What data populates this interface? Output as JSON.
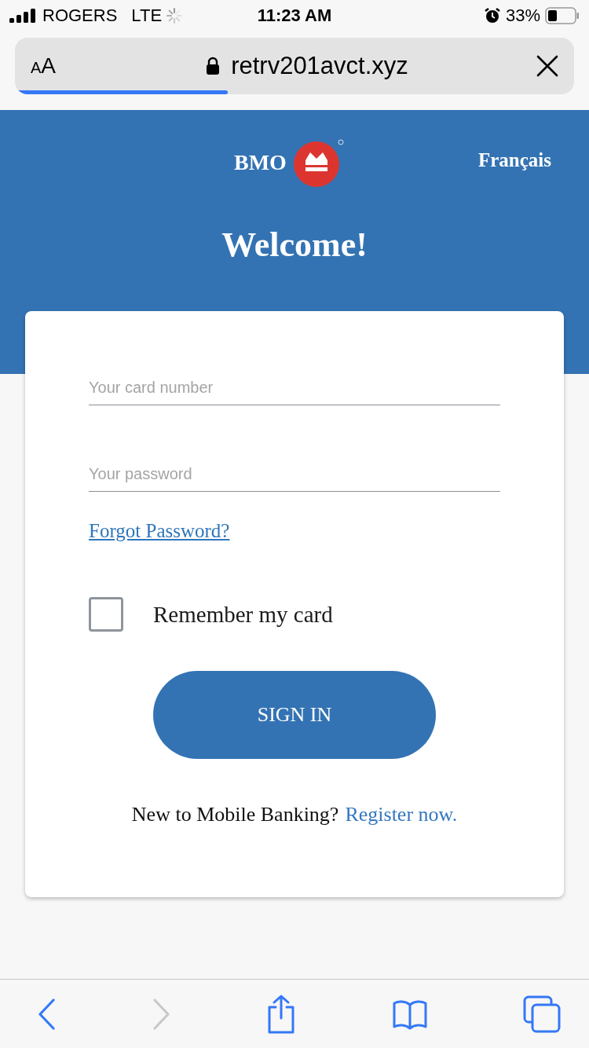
{
  "status_bar": {
    "carrier": "ROGERS",
    "network": "LTE",
    "time": "11:23 AM",
    "battery": "33%"
  },
  "browser": {
    "text_size_button": "AA",
    "url": "retrv201avct.xyz",
    "load": {
      "level": 0.38
    }
  },
  "header": {
    "logo_text": "BMO",
    "language_link": "Français",
    "title": "Welcome!"
  },
  "login": {
    "fields": [
      {
        "placeholder": "Your card number"
      },
      {
        "placeholder": "Your password"
      }
    ],
    "forgot_link": "Forgot Password?",
    "remember": {
      "label": "Remember my card",
      "checked": false
    },
    "sign_in_button": "SIGN IN",
    "register": {
      "prompt": "New to Mobile Banking?",
      "link": "Register now."
    }
  },
  "toolbar": {
    "back_disabled": false,
    "forward_disabled": true
  }
}
